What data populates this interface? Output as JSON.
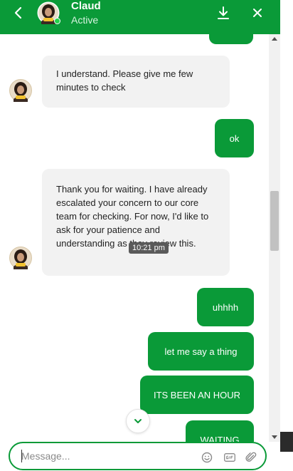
{
  "colors": {
    "accent": "#0a9a38"
  },
  "header": {
    "contact_name": "Claud",
    "status": "Active",
    "icons": {
      "back": "chevron-left-icon",
      "download": "download-icon",
      "close": "close-icon"
    }
  },
  "messages": [
    {
      "direction": "in",
      "text": "I understand. Please give me few minutes to check"
    },
    {
      "direction": "out",
      "text": "ok"
    },
    {
      "direction": "in",
      "text": "Thank you for waiting. I have already escalated your concern to our core team for checking. For now, I'd like to ask for your patience and understanding as they review this."
    },
    {
      "direction": "out",
      "text": "uhhhh"
    },
    {
      "direction": "out",
      "text": "let me say a thing"
    },
    {
      "direction": "out",
      "text": "ITS BEEN AN HOUR"
    },
    {
      "direction": "out",
      "text": "WAITING"
    }
  ],
  "timestamp_tooltip": "10:21 pm",
  "composer": {
    "placeholder": "Message...",
    "icons": {
      "emoji": "emoji-icon",
      "gif": "gif-icon",
      "attach": "paperclip-icon"
    }
  }
}
